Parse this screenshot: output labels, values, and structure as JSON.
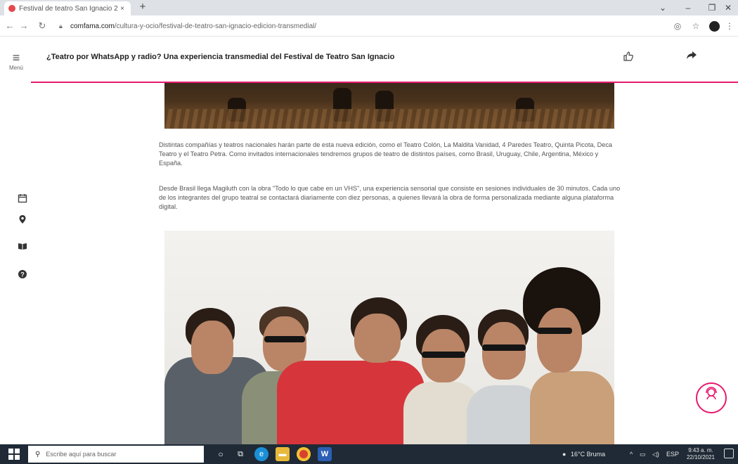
{
  "browser": {
    "tab_title": "Festival de teatro San Ignacio 2",
    "tab_close": "×",
    "new_tab": "+",
    "window_controls": [
      "⌄",
      "–",
      "❐",
      "✕"
    ],
    "url_domain": "comfama.com",
    "url_path": "/cultura-y-ocio/festival-de-teatro-san-ignacio-edicion-transmedial/"
  },
  "rail": {
    "menu_label": "Menú",
    "icons": [
      "calendar-icon",
      "location-pin-icon",
      "book-icon",
      "help-circle-icon"
    ]
  },
  "header": {
    "title": "¿Teatro por WhatsApp y radio? Una experiencia transmedial del Festival de Teatro San Ignacio"
  },
  "article": {
    "paragraphs": [
      "Distintas compañías y teatros nacionales harán parte de esta nueva edición, como el Teatro Colón, La Maldita Vanidad, 4 Paredes Teatro, Quinta Picota, Deca Teatro y el Teatro Petra. Como invitados internacionales tendremos grupos de teatro de distintos países, como Brasil, Uruguay, Chile, Argentina, México y España.",
      "Desde Brasil llega Magiluth con la obra \"Todo lo que cabe en un VHS\", una experiencia sensorial que consiste en sesiones individuales de 30 minutos. Cada uno de los integrantes del grupo teatral se contactará diariamente con diez personas, a quienes llevará la obra de forma personalizada mediante alguna plataforma digital."
    ]
  },
  "taskbar": {
    "search_placeholder": "Escribe aquí para buscar",
    "weather": "16°C Bruma",
    "language": "ESP",
    "time": "9:43 a. m.",
    "date": "22/10/2021"
  },
  "colors": {
    "accent": "#e8196e",
    "taskbar": "#1f2a36"
  }
}
